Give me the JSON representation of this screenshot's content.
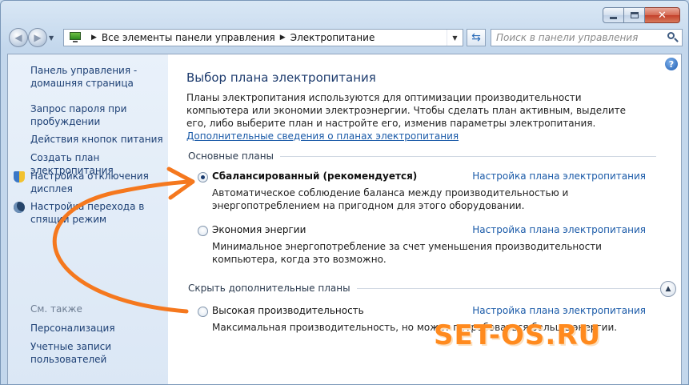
{
  "window": {
    "caption_buttons": {
      "minimize_icon": "minimize-icon",
      "maximize_icon": "maximize-icon",
      "close_icon": "close-icon",
      "close_glyph": "✕"
    }
  },
  "nav": {
    "back_icon": "back-arrow-icon",
    "forward_icon": "forward-arrow-icon",
    "breadcrumb": [
      "Все элементы панели управления",
      "Электропитание"
    ],
    "search_placeholder": "Поиск в панели управления"
  },
  "sidebar": {
    "home_link": "Панель управления - домашняя страница",
    "links": [
      {
        "label": "Запрос пароля при пробуждении"
      },
      {
        "label": "Действия кнопок питания"
      },
      {
        "label": "Создать план электропитания"
      },
      {
        "label": "Настройка отключения дисплея",
        "icon": "shield-icon"
      },
      {
        "label": "Настройка перехода в спящий режим",
        "icon": "sleep-icon"
      }
    ],
    "see_also_title": "См. также",
    "see_also": [
      {
        "label": "Персонализация"
      },
      {
        "label": "Учетные записи пользователей"
      }
    ]
  },
  "main": {
    "title": "Выбор плана электропитания",
    "intro_text": "Планы электропитания используются для оптимизации производительности компьютера или экономии электроэнергии. Чтобы сделать план активным, выделите его, либо выберите план и настройте его, изменив параметры электропитания. ",
    "intro_link": "Дополнительные сведения о планах электропитания",
    "basic_plans_header": "Основные планы",
    "hidden_plans_header": "Скрыть дополнительные планы",
    "plans": [
      {
        "name": "Сбалансированный (рекомендуется)",
        "selected": true,
        "link": "Настройка плана электропитания",
        "description": "Автоматическое соблюдение баланса между производительностью и энергопотреблением на пригодном для этого оборудовании."
      },
      {
        "name": "Экономия энергии",
        "selected": false,
        "link": "Настройка плана электропитания",
        "description": "Минимальное энергопотребление за счет уменьшения производительности компьютера, когда это возможно."
      },
      {
        "name": "Высокая производительность",
        "selected": false,
        "link": "Настройка плана электропитания",
        "description": "Максимальная производительность, но может потребоваться больше энергии."
      }
    ]
  },
  "overlay": {
    "watermark": "SET-OS.RU",
    "arrow_color": "#f5781e"
  }
}
